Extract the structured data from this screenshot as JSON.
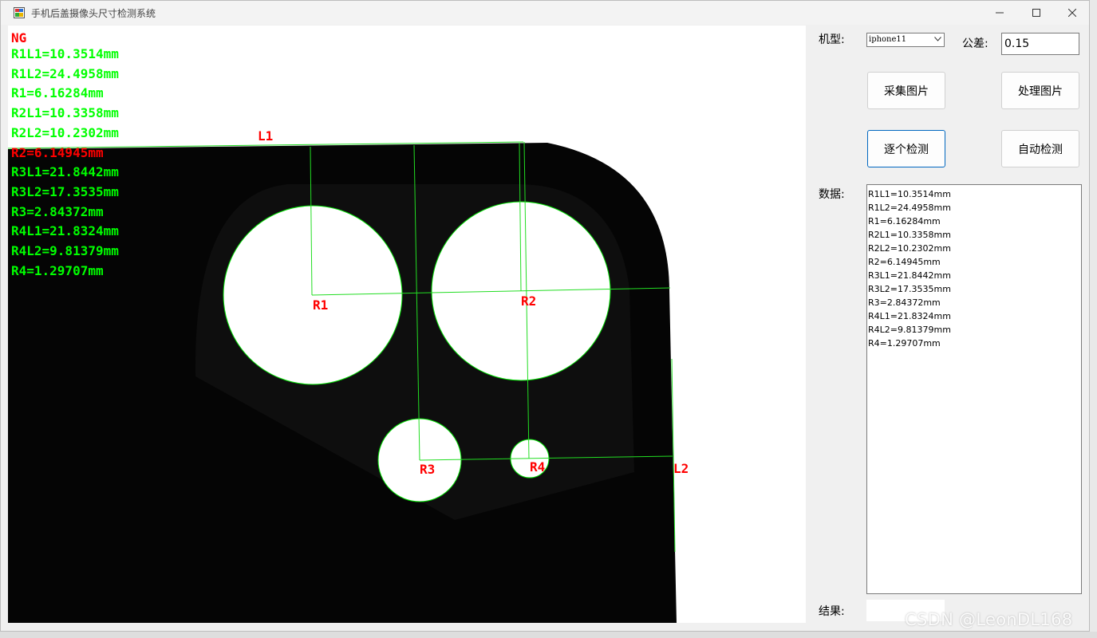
{
  "window": {
    "title": "手机后盖摄像头尺寸检测系统",
    "icon": "app-window-icon"
  },
  "overlay": {
    "status": "NG",
    "status_color": "#ff0000",
    "pass_color": "#00ff00",
    "lines": [
      {
        "text": "R1L1=10.3514mm",
        "ok": true
      },
      {
        "text": "R1L2=24.4958mm",
        "ok": true
      },
      {
        "text": "R1=6.16284mm",
        "ok": true
      },
      {
        "text": "R2L1=10.3358mm",
        "ok": true
      },
      {
        "text": "R2L2=10.2302mm",
        "ok": true
      },
      {
        "text": "R2=6.14945mm",
        "ok": false
      },
      {
        "text": "R3L1=21.8442mm",
        "ok": true
      },
      {
        "text": "R3L2=17.3535mm",
        "ok": true
      },
      {
        "text": "R3=2.84372mm",
        "ok": true
      },
      {
        "text": "R4L1=21.8324mm",
        "ok": true
      },
      {
        "text": "R4L2=9.81379mm",
        "ok": true
      },
      {
        "text": "R4=1.29707mm",
        "ok": true
      }
    ],
    "labels": {
      "l1": "L1",
      "l2": "L2",
      "r1": "R1",
      "r2": "R2",
      "r3": "R3",
      "r4": "R4"
    }
  },
  "panel": {
    "model_label": "机型:",
    "model_value": "iphone11",
    "tolerance_label": "公差:",
    "tolerance_value": "0.15",
    "btn_capture": "采集图片",
    "btn_process": "处理图片",
    "btn_step": "逐个检测",
    "btn_auto": "自动检测",
    "data_label": "数据:",
    "data_items": [
      "R1L1=10.3514mm",
      "R1L2=24.4958mm",
      "R1=6.16284mm",
      "R2L1=10.3358mm",
      "R2L2=10.2302mm",
      "R2=6.14945mm",
      "R3L1=21.8442mm",
      "R3L2=17.3535mm",
      "R3=2.84372mm",
      "R4L1=21.8324mm",
      "R4L2=9.81379mm",
      "R4=1.29707mm"
    ],
    "result_label": "结果:",
    "result_value": ""
  },
  "watermark": "CSDN @LeonDL168"
}
